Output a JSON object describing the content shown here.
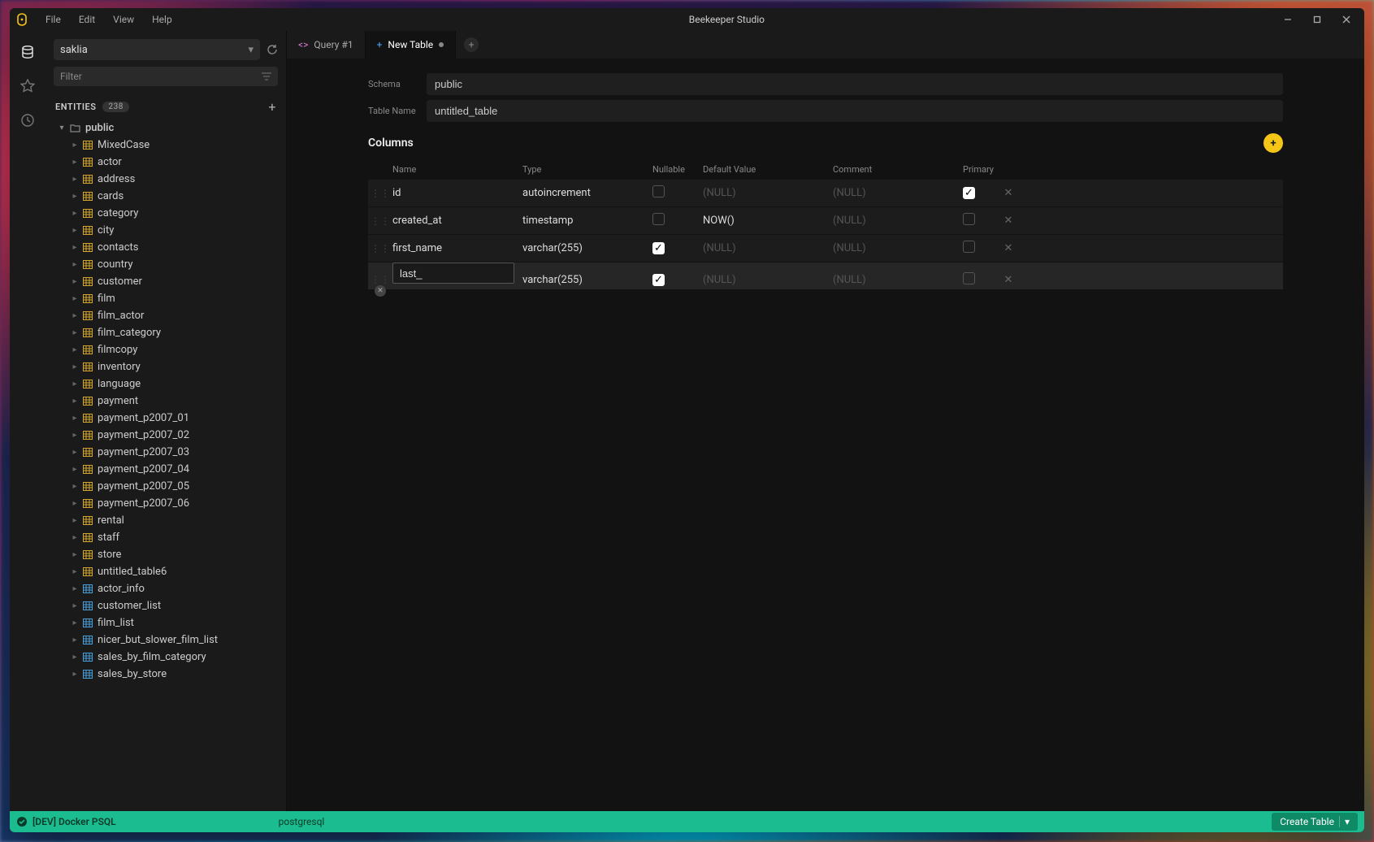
{
  "titlebar": {
    "app_title": "Beekeeper Studio",
    "menus": [
      "File",
      "Edit",
      "View",
      "Help"
    ]
  },
  "rail": {
    "items": [
      "database-icon",
      "star-icon",
      "history-icon"
    ]
  },
  "sidebar": {
    "database": "saklia",
    "filter_placeholder": "Filter",
    "entities_label": "ENTITIES",
    "entities_count": "238",
    "schema": "public",
    "tables": [
      {
        "name": "MixedCase",
        "kind": "table"
      },
      {
        "name": "actor",
        "kind": "table"
      },
      {
        "name": "address",
        "kind": "table"
      },
      {
        "name": "cards",
        "kind": "table"
      },
      {
        "name": "category",
        "kind": "table"
      },
      {
        "name": "city",
        "kind": "table"
      },
      {
        "name": "contacts",
        "kind": "table"
      },
      {
        "name": "country",
        "kind": "table"
      },
      {
        "name": "customer",
        "kind": "table"
      },
      {
        "name": "film",
        "kind": "table"
      },
      {
        "name": "film_actor",
        "kind": "table"
      },
      {
        "name": "film_category",
        "kind": "table"
      },
      {
        "name": "filmcopy",
        "kind": "table"
      },
      {
        "name": "inventory",
        "kind": "table"
      },
      {
        "name": "language",
        "kind": "table"
      },
      {
        "name": "payment",
        "kind": "table"
      },
      {
        "name": "payment_p2007_01",
        "kind": "table"
      },
      {
        "name": "payment_p2007_02",
        "kind": "table"
      },
      {
        "name": "payment_p2007_03",
        "kind": "table"
      },
      {
        "name": "payment_p2007_04",
        "kind": "table"
      },
      {
        "name": "payment_p2007_05",
        "kind": "table"
      },
      {
        "name": "payment_p2007_06",
        "kind": "table"
      },
      {
        "name": "rental",
        "kind": "table"
      },
      {
        "name": "staff",
        "kind": "table"
      },
      {
        "name": "store",
        "kind": "table"
      },
      {
        "name": "untitled_table6",
        "kind": "table"
      },
      {
        "name": "actor_info",
        "kind": "view"
      },
      {
        "name": "customer_list",
        "kind": "view"
      },
      {
        "name": "film_list",
        "kind": "view"
      },
      {
        "name": "nicer_but_slower_film_list",
        "kind": "view"
      },
      {
        "name": "sales_by_film_category",
        "kind": "view"
      },
      {
        "name": "sales_by_store",
        "kind": "view"
      }
    ]
  },
  "tabs": [
    {
      "label": "Query #1",
      "kind": "query",
      "active": false
    },
    {
      "label": "New Table",
      "kind": "newtable",
      "active": true,
      "dirty": true
    }
  ],
  "form": {
    "schema_label": "Schema",
    "schema_value": "public",
    "tablename_label": "Table Name",
    "tablename_value": "untitled_table"
  },
  "columns": {
    "title": "Columns",
    "headers": {
      "name": "Name",
      "type": "Type",
      "nullable": "Nullable",
      "default": "Default Value",
      "comment": "Comment",
      "primary": "Primary"
    },
    "rows": [
      {
        "name": "id",
        "type": "autoincrement",
        "nullable": false,
        "default": "(NULL)",
        "default_null": true,
        "comment": "(NULL)",
        "primary": true,
        "editing": false
      },
      {
        "name": "created_at",
        "type": "timestamp",
        "nullable": false,
        "default": "NOW()",
        "default_null": false,
        "comment": "(NULL)",
        "primary": false,
        "editing": false
      },
      {
        "name": "first_name",
        "type": "varchar(255)",
        "nullable": true,
        "default": "(NULL)",
        "default_null": true,
        "comment": "(NULL)",
        "primary": false,
        "editing": false
      },
      {
        "name": "last_",
        "type": "varchar(255)",
        "nullable": true,
        "default": "(NULL)",
        "default_null": true,
        "comment": "(NULL)",
        "primary": false,
        "editing": true
      }
    ]
  },
  "statusbar": {
    "connection": "[DEV] Docker PSQL",
    "engine": "postgresql",
    "create_label": "Create Table"
  }
}
